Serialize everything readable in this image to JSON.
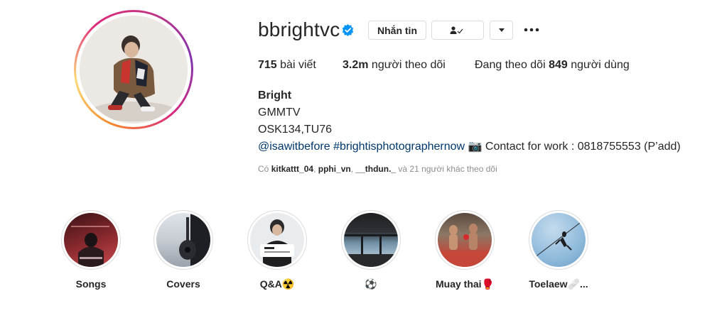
{
  "profile": {
    "username": "bbrightvc",
    "verified_icon": "verified-badge-icon",
    "buttons": {
      "message": "Nhắn tin",
      "following_icon": "person-check-icon",
      "dropdown_icon": "caret-down-icon",
      "more_icon": "more-horizontal-icon"
    },
    "stats": {
      "posts_count": "715",
      "posts_label": " bài viết",
      "followers_count": "3.2m",
      "followers_label": " người theo dõi",
      "following_prefix": "Đang theo dõi ",
      "following_count": "849",
      "following_suffix": " người dùng"
    },
    "bio": {
      "name": "Bright",
      "line1": "GMMTV",
      "line2": "OSK134,TU76",
      "tag1": "@isawitbefore",
      "tag2": "#brightisphotographernow",
      "camera": "📷",
      "contact": " Contact for work : 0818755553 (P’add)"
    },
    "followed_by": {
      "prefix": "Có ",
      "user1": "kitkattt_04",
      "sep1": ", ",
      "user2": "pphi_vn",
      "sep2": ", ",
      "user3": "__thdun._",
      "suffix": " và 21 người khác theo dõi"
    }
  },
  "highlights": [
    {
      "label": "Songs"
    },
    {
      "label": "Covers"
    },
    {
      "label": "Q&A☢️"
    },
    {
      "label": "⚽"
    },
    {
      "label": "Muay thai🥊"
    },
    {
      "label": "Toelaew🩹..."
    }
  ],
  "colors": {
    "accent_link": "#00376b",
    "verified": "#0095f6",
    "text": "#262626",
    "muted": "#8e8e8e",
    "border": "#dbdbdb"
  }
}
